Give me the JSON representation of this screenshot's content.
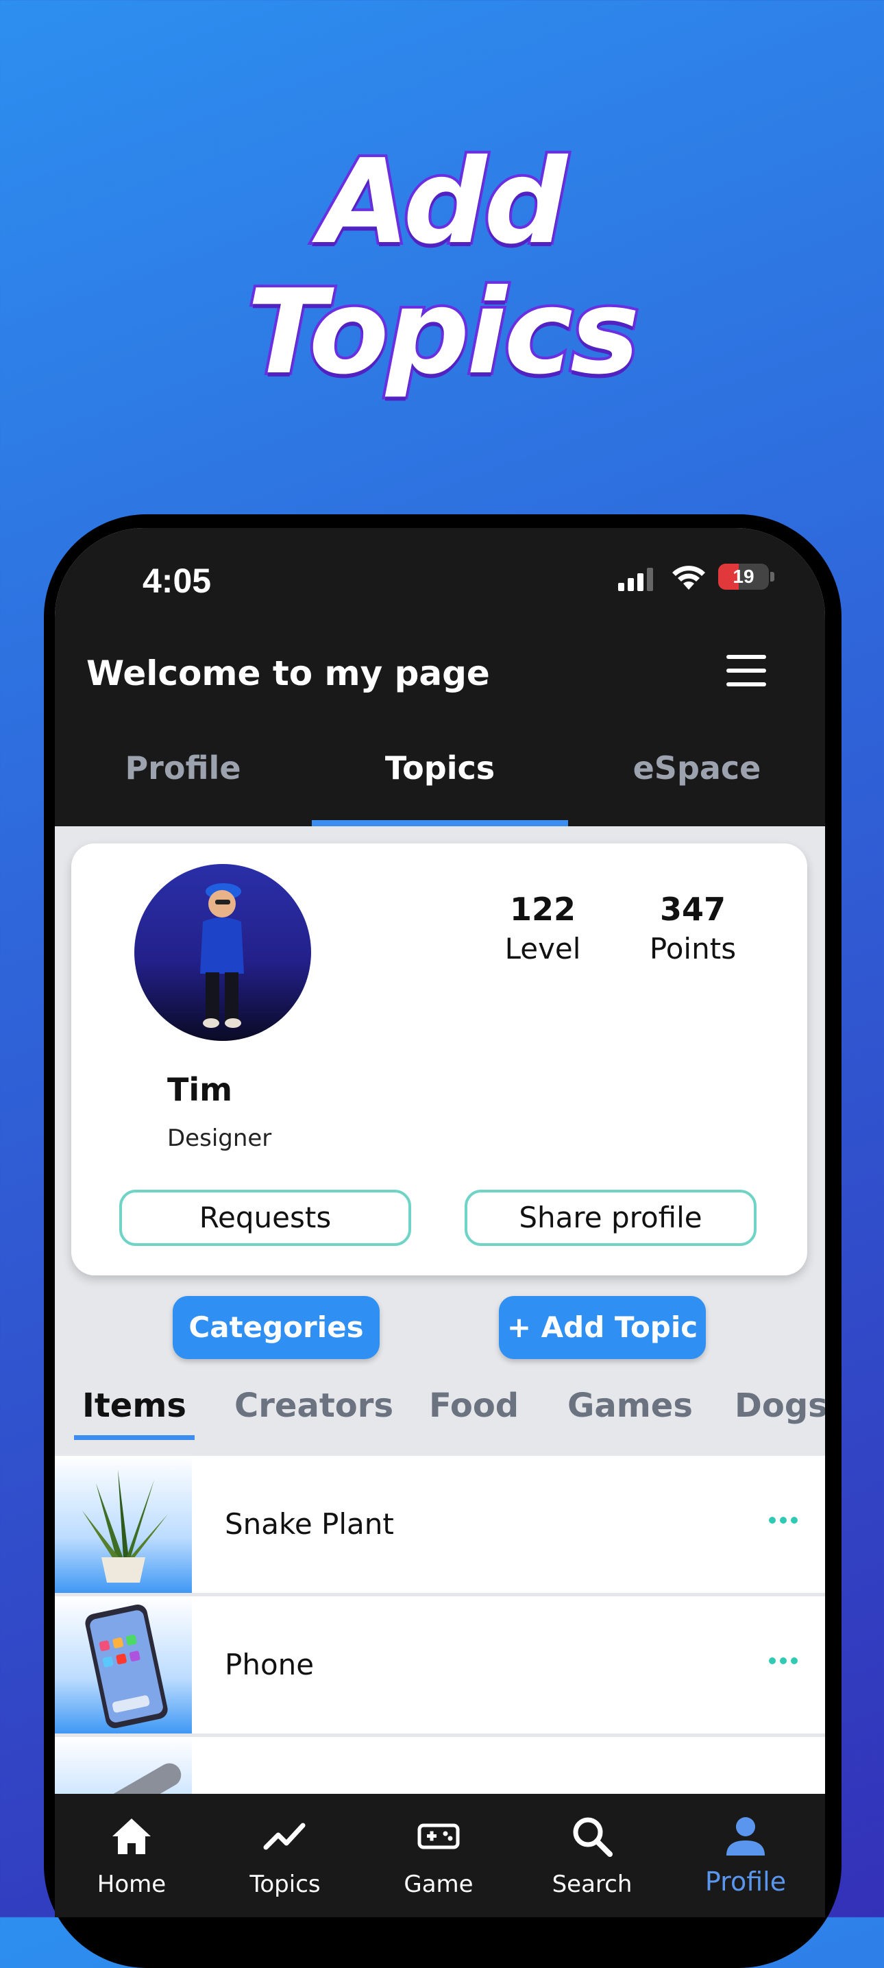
{
  "headline": {
    "line1": "Add",
    "line2": "Topics"
  },
  "status_bar": {
    "time": "4:05",
    "battery": "19"
  },
  "app_bar": {
    "title": "Welcome to my page"
  },
  "tabs": [
    {
      "label": "Profile",
      "active": false
    },
    {
      "label": "Topics",
      "active": true
    },
    {
      "label": "eSpace",
      "active": false
    }
  ],
  "profile": {
    "name": "Tim",
    "role": "Designer",
    "stats": [
      {
        "value": "122",
        "label": "Level"
      },
      {
        "value": "347",
        "label": "Points"
      }
    ],
    "requests_label": "Requests",
    "share_label": "Share profile"
  },
  "actions": {
    "categories_label": "Categories",
    "add_topic_label": "+ Add Topic"
  },
  "sub_tabs": [
    {
      "label": "Items",
      "active": true
    },
    {
      "label": "Creators",
      "active": false
    },
    {
      "label": "Food",
      "active": false
    },
    {
      "label": "Games",
      "active": false
    },
    {
      "label": "Dogs",
      "active": false
    }
  ],
  "items": [
    {
      "label": "Snake Plant",
      "icon": "snake-plant-image"
    },
    {
      "label": "Phone",
      "icon": "phone-image"
    },
    {
      "label": "",
      "icon": "partial-item-image"
    }
  ],
  "bottom_nav": [
    {
      "label": "Home",
      "icon": "home-icon",
      "active": false
    },
    {
      "label": "Topics",
      "icon": "trending-icon",
      "active": false
    },
    {
      "label": "Game",
      "icon": "gamepad-icon",
      "active": false
    },
    {
      "label": "Search",
      "icon": "search-icon",
      "active": false
    },
    {
      "label": "Profile",
      "icon": "person-icon",
      "active": true
    }
  ],
  "colors": {
    "accent": "#2f8ff2",
    "tab_indicator": "#3b8ef0",
    "outline": "#6fd3c6",
    "dots": "#2fc9b4"
  }
}
